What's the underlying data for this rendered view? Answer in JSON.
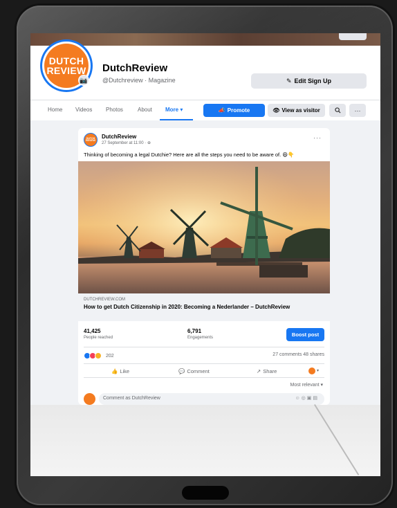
{
  "page": {
    "name": "DutchReview",
    "handle": "@Dutchreview · Magazine",
    "avatar_text": [
      "DUTCH",
      "REVIEW"
    ],
    "edit_signup_label": "Edit Sign Up"
  },
  "tabs": {
    "items": [
      "Home",
      "Videos",
      "Photos",
      "About",
      "More"
    ],
    "active": "More",
    "promote_label": "Promote",
    "view_as_visitor_label": "View as visitor",
    "more_dots": "···"
  },
  "post": {
    "author": "DutchReview",
    "meta": "27 September at 11:00 · ",
    "text": "Thinking of becoming a legal Dutchie? Here are all the steps you need to be aware of. 😄👇",
    "link_domain": "DUTCHREVIEW.COM",
    "link_title": "How to get Dutch Citizenship in 2020: Becoming a Nederlander – DutchReview",
    "stats": {
      "reached_value": "41,425",
      "reached_label": "People reached",
      "engagements_value": "6,791",
      "engagements_label": "Engagements"
    },
    "boost_label": "Boost post",
    "reaction_count": "202",
    "comments_shares": "27 comments  48 shares",
    "actions": {
      "like": "Like",
      "comment": "Comment",
      "share": "Share"
    },
    "sort_label": "Most relevant ▾",
    "comment_placeholder": "Comment as DutchReview"
  },
  "colors": {
    "brand_blue": "#1877f2",
    "brand_orange": "#f47b20",
    "like_blue": "#1877f2",
    "love_red": "#f33e58",
    "haha_yellow": "#f7b125"
  },
  "icons": {
    "camera": "camera-icon",
    "pencil": "pencil-icon",
    "megaphone": "megaphone-icon",
    "eye": "eye-icon",
    "search": "search-icon",
    "globe": "globe-icon",
    "like": "thumbs-up-icon",
    "comment": "speech-bubble-icon",
    "share": "share-arrow-icon"
  }
}
